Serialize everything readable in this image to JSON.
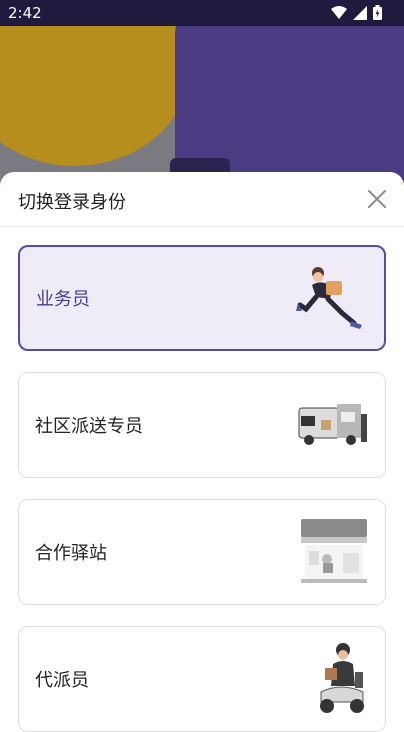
{
  "status_bar": {
    "time": "2:42"
  },
  "sheet": {
    "title": "切换登录身份",
    "roles": [
      {
        "label": "业务员",
        "selected": true,
        "illustration": "courier-running-icon"
      },
      {
        "label": "社区派送专员",
        "selected": false,
        "illustration": "delivery-truck-icon"
      },
      {
        "label": "合作驿站",
        "selected": false,
        "illustration": "storefront-icon"
      },
      {
        "label": "代派员",
        "selected": false,
        "illustration": "scooter-rider-icon"
      }
    ]
  },
  "colors": {
    "accent": "#5a4aa3",
    "selected_bg": "#efecf8"
  }
}
